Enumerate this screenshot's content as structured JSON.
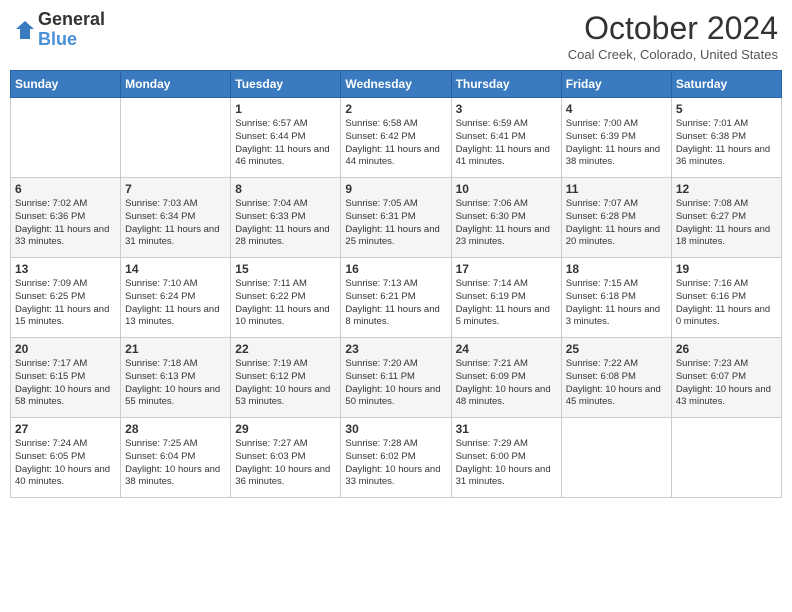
{
  "logo": {
    "general": "General",
    "blue": "Blue"
  },
  "header": {
    "title": "October 2024",
    "location": "Coal Creek, Colorado, United States"
  },
  "days_of_week": [
    "Sunday",
    "Monday",
    "Tuesday",
    "Wednesday",
    "Thursday",
    "Friday",
    "Saturday"
  ],
  "weeks": [
    [
      {
        "day": "",
        "info": ""
      },
      {
        "day": "",
        "info": ""
      },
      {
        "day": "1",
        "info": "Sunrise: 6:57 AM\nSunset: 6:44 PM\nDaylight: 11 hours and 46 minutes."
      },
      {
        "day": "2",
        "info": "Sunrise: 6:58 AM\nSunset: 6:42 PM\nDaylight: 11 hours and 44 minutes."
      },
      {
        "day": "3",
        "info": "Sunrise: 6:59 AM\nSunset: 6:41 PM\nDaylight: 11 hours and 41 minutes."
      },
      {
        "day": "4",
        "info": "Sunrise: 7:00 AM\nSunset: 6:39 PM\nDaylight: 11 hours and 38 minutes."
      },
      {
        "day": "5",
        "info": "Sunrise: 7:01 AM\nSunset: 6:38 PM\nDaylight: 11 hours and 36 minutes."
      }
    ],
    [
      {
        "day": "6",
        "info": "Sunrise: 7:02 AM\nSunset: 6:36 PM\nDaylight: 11 hours and 33 minutes."
      },
      {
        "day": "7",
        "info": "Sunrise: 7:03 AM\nSunset: 6:34 PM\nDaylight: 11 hours and 31 minutes."
      },
      {
        "day": "8",
        "info": "Sunrise: 7:04 AM\nSunset: 6:33 PM\nDaylight: 11 hours and 28 minutes."
      },
      {
        "day": "9",
        "info": "Sunrise: 7:05 AM\nSunset: 6:31 PM\nDaylight: 11 hours and 25 minutes."
      },
      {
        "day": "10",
        "info": "Sunrise: 7:06 AM\nSunset: 6:30 PM\nDaylight: 11 hours and 23 minutes."
      },
      {
        "day": "11",
        "info": "Sunrise: 7:07 AM\nSunset: 6:28 PM\nDaylight: 11 hours and 20 minutes."
      },
      {
        "day": "12",
        "info": "Sunrise: 7:08 AM\nSunset: 6:27 PM\nDaylight: 11 hours and 18 minutes."
      }
    ],
    [
      {
        "day": "13",
        "info": "Sunrise: 7:09 AM\nSunset: 6:25 PM\nDaylight: 11 hours and 15 minutes."
      },
      {
        "day": "14",
        "info": "Sunrise: 7:10 AM\nSunset: 6:24 PM\nDaylight: 11 hours and 13 minutes."
      },
      {
        "day": "15",
        "info": "Sunrise: 7:11 AM\nSunset: 6:22 PM\nDaylight: 11 hours and 10 minutes."
      },
      {
        "day": "16",
        "info": "Sunrise: 7:13 AM\nSunset: 6:21 PM\nDaylight: 11 hours and 8 minutes."
      },
      {
        "day": "17",
        "info": "Sunrise: 7:14 AM\nSunset: 6:19 PM\nDaylight: 11 hours and 5 minutes."
      },
      {
        "day": "18",
        "info": "Sunrise: 7:15 AM\nSunset: 6:18 PM\nDaylight: 11 hours and 3 minutes."
      },
      {
        "day": "19",
        "info": "Sunrise: 7:16 AM\nSunset: 6:16 PM\nDaylight: 11 hours and 0 minutes."
      }
    ],
    [
      {
        "day": "20",
        "info": "Sunrise: 7:17 AM\nSunset: 6:15 PM\nDaylight: 10 hours and 58 minutes."
      },
      {
        "day": "21",
        "info": "Sunrise: 7:18 AM\nSunset: 6:13 PM\nDaylight: 10 hours and 55 minutes."
      },
      {
        "day": "22",
        "info": "Sunrise: 7:19 AM\nSunset: 6:12 PM\nDaylight: 10 hours and 53 minutes."
      },
      {
        "day": "23",
        "info": "Sunrise: 7:20 AM\nSunset: 6:11 PM\nDaylight: 10 hours and 50 minutes."
      },
      {
        "day": "24",
        "info": "Sunrise: 7:21 AM\nSunset: 6:09 PM\nDaylight: 10 hours and 48 minutes."
      },
      {
        "day": "25",
        "info": "Sunrise: 7:22 AM\nSunset: 6:08 PM\nDaylight: 10 hours and 45 minutes."
      },
      {
        "day": "26",
        "info": "Sunrise: 7:23 AM\nSunset: 6:07 PM\nDaylight: 10 hours and 43 minutes."
      }
    ],
    [
      {
        "day": "27",
        "info": "Sunrise: 7:24 AM\nSunset: 6:05 PM\nDaylight: 10 hours and 40 minutes."
      },
      {
        "day": "28",
        "info": "Sunrise: 7:25 AM\nSunset: 6:04 PM\nDaylight: 10 hours and 38 minutes."
      },
      {
        "day": "29",
        "info": "Sunrise: 7:27 AM\nSunset: 6:03 PM\nDaylight: 10 hours and 36 minutes."
      },
      {
        "day": "30",
        "info": "Sunrise: 7:28 AM\nSunset: 6:02 PM\nDaylight: 10 hours and 33 minutes."
      },
      {
        "day": "31",
        "info": "Sunrise: 7:29 AM\nSunset: 6:00 PM\nDaylight: 10 hours and 31 minutes."
      },
      {
        "day": "",
        "info": ""
      },
      {
        "day": "",
        "info": ""
      }
    ]
  ]
}
